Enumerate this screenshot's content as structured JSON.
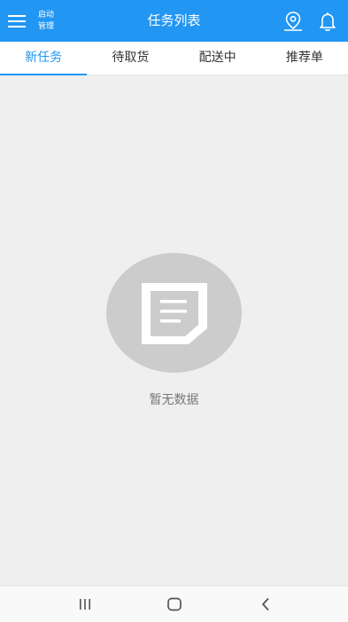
{
  "header": {
    "start_manage_line1": "启动",
    "start_manage_line2": "管理",
    "title": "任务列表",
    "icons": [
      "menu-icon",
      "location-icon",
      "bell-icon"
    ],
    "accent_color": "#2196f3"
  },
  "tabs": [
    {
      "label": "新任务",
      "active": true
    },
    {
      "label": "待取货",
      "active": false
    },
    {
      "label": "配送中",
      "active": false
    },
    {
      "label": "推荐单",
      "active": false
    }
  ],
  "empty_state": {
    "icon": "document-icon",
    "message": "暂无数据"
  },
  "system_nav": {
    "icons": [
      "recent-apps-icon",
      "home-icon",
      "back-icon"
    ]
  }
}
